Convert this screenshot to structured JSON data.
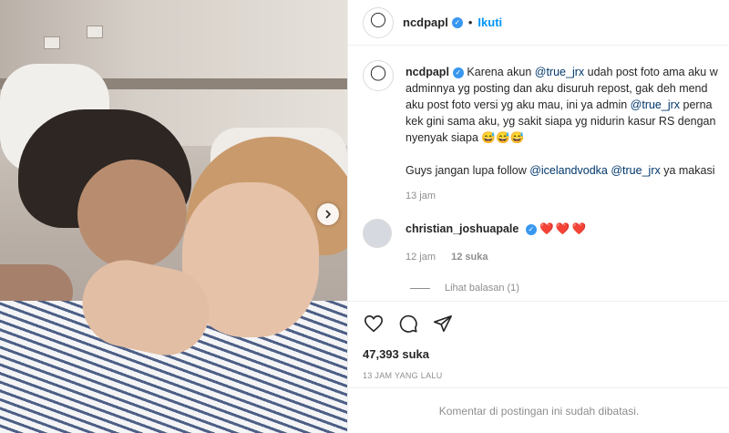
{
  "header": {
    "username": "ncdpapl",
    "separator": "•",
    "follow_label": "Ikuti"
  },
  "caption": {
    "username": "ncdpapl",
    "lines": [
      [
        "Karena akun ",
        "@true_jrx",
        " udah post foto ama aku w"
      ],
      [
        "adminnya yg posting dan aku disuruh repost, gak deh mend",
        "",
        ""
      ],
      [
        "aku post foto versi yg aku mau, ini ya admin ",
        "@true_jrx",
        " perna"
      ],
      [
        "kek gini sama aku, yg sakit siapa yg nidurin kasur RS dengan",
        "",
        ""
      ],
      [
        "nyenyak siapa 😅😅😅",
        "",
        ""
      ]
    ],
    "follow_line": [
      "Guys jangan lupa follow ",
      "@icelandvodka",
      " ",
      "@true_jrx",
      " ya makasi"
    ],
    "time": "13 jam"
  },
  "comment": {
    "username": "christian_joshuapale",
    "hearts": "❤️❤️❤️",
    "time": "12 jam",
    "likes": "12 suka",
    "replies": "Lihat balasan (1)"
  },
  "post": {
    "likes": "47,393 suka",
    "time": "13 JAM YANG LALU",
    "comments_closed": "Komentar di postingan ini sudah dibatasi."
  },
  "colors": {
    "accent": "#0095f6",
    "mention": "#00376b",
    "muted": "#8e8e8e",
    "verified": "#3897f0"
  },
  "icons": {
    "next": "chevron-right-icon",
    "like": "heart-icon",
    "comment": "comment-bubble-icon",
    "share": "paper-plane-icon",
    "verified": "verified-badge-icon"
  }
}
